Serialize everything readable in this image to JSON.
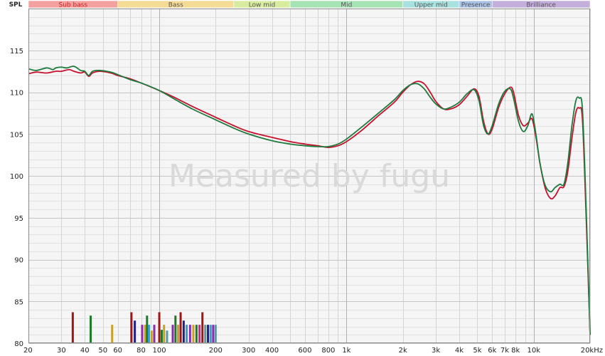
{
  "chart_data": {
    "type": "line",
    "y_axis_label": "SPL",
    "x_scale": "log",
    "xlim": [
      20,
      20000
    ],
    "ylim": [
      80,
      120
    ],
    "grid": true,
    "watermark": "Measured by fugu",
    "x_ticks": [
      {
        "v": 20,
        "label": "20"
      },
      {
        "v": 30,
        "label": "30"
      },
      {
        "v": 40,
        "label": "40"
      },
      {
        "v": 50,
        "label": "50"
      },
      {
        "v": 60,
        "label": "60"
      },
      {
        "v": 80,
        "label": "80"
      },
      {
        "v": 100,
        "label": "100"
      },
      {
        "v": 200,
        "label": "200"
      },
      {
        "v": 300,
        "label": "300"
      },
      {
        "v": 400,
        "label": "400"
      },
      {
        "v": 600,
        "label": "600"
      },
      {
        "v": 800,
        "label": "800"
      },
      {
        "v": 1000,
        "label": "1k"
      },
      {
        "v": 2000,
        "label": "2k"
      },
      {
        "v": 3000,
        "label": "3k"
      },
      {
        "v": 4000,
        "label": "4k"
      },
      {
        "v": 5000,
        "label": "5k"
      },
      {
        "v": 6000,
        "label": "6k"
      },
      {
        "v": 7000,
        "label": "7k"
      },
      {
        "v": 8000,
        "label": "8k"
      },
      {
        "v": 10000,
        "label": "10k"
      },
      {
        "v": 20000,
        "label": "20kHz"
      }
    ],
    "y_ticks": [
      80,
      85,
      90,
      95,
      100,
      105,
      110,
      115
    ],
    "bands": [
      {
        "name": "Sub bass",
        "from": 20,
        "to": 60,
        "color": "#f4a0a0",
        "text_color": "#cc2222"
      },
      {
        "name": "Bass",
        "from": 60,
        "to": 250,
        "color": "#f5dc96",
        "text_color": "#555555"
      },
      {
        "name": "Low mid",
        "from": 250,
        "to": 500,
        "color": "#d8eca0",
        "text_color": "#555555"
      },
      {
        "name": "Mid",
        "from": 500,
        "to": 2000,
        "color": "#a6e3b4",
        "text_color": "#555555"
      },
      {
        "name": "Upper mid",
        "from": 2000,
        "to": 4000,
        "color": "#a8e2de",
        "text_color": "#555555"
      },
      {
        "name": "Presence",
        "from": 4000,
        "to": 6000,
        "color": "#aac2e6",
        "text_color": "#555555"
      },
      {
        "name": "Brilliance",
        "from": 6000,
        "to": 20000,
        "color": "#c4aedb",
        "text_color": "#555555"
      }
    ],
    "series": [
      {
        "color": "#c8102e",
        "points": [
          [
            20,
            112.2
          ],
          [
            22,
            112.4
          ],
          [
            25,
            112.3
          ],
          [
            28,
            112.5
          ],
          [
            30,
            112.5
          ],
          [
            33,
            112.7
          ],
          [
            35,
            112.5
          ],
          [
            38,
            112.3
          ],
          [
            40,
            112.4
          ],
          [
            42,
            111.9
          ],
          [
            44,
            112.3
          ],
          [
            48,
            112.5
          ],
          [
            55,
            112.3
          ],
          [
            60,
            112.0
          ],
          [
            70,
            111.6
          ],
          [
            80,
            111.1
          ],
          [
            100,
            110.2
          ],
          [
            120,
            109.4
          ],
          [
            150,
            108.3
          ],
          [
            200,
            107.0
          ],
          [
            250,
            106.0
          ],
          [
            300,
            105.3
          ],
          [
            400,
            104.6
          ],
          [
            500,
            104.1
          ],
          [
            600,
            103.8
          ],
          [
            700,
            103.6
          ],
          [
            800,
            103.4
          ],
          [
            900,
            103.6
          ],
          [
            1000,
            104.1
          ],
          [
            1200,
            105.4
          ],
          [
            1500,
            107.3
          ],
          [
            1800,
            108.8
          ],
          [
            2000,
            110.0
          ],
          [
            2200,
            110.9
          ],
          [
            2400,
            111.3
          ],
          [
            2600,
            111.0
          ],
          [
            2800,
            110.0
          ],
          [
            3000,
            108.9
          ],
          [
            3300,
            108.0
          ],
          [
            3600,
            108.0
          ],
          [
            4000,
            108.5
          ],
          [
            4400,
            109.5
          ],
          [
            4800,
            110.4
          ],
          [
            5100,
            109.5
          ],
          [
            5400,
            106.5
          ],
          [
            5700,
            105.0
          ],
          [
            6000,
            105.6
          ],
          [
            6500,
            108.2
          ],
          [
            7000,
            109.8
          ],
          [
            7500,
            110.6
          ],
          [
            7800,
            110.0
          ],
          [
            8300,
            107.2
          ],
          [
            8800,
            106.0
          ],
          [
            9300,
            106.3
          ],
          [
            9800,
            106.8
          ],
          [
            10300,
            104.5
          ],
          [
            10800,
            101.5
          ],
          [
            11500,
            98.6
          ],
          [
            12300,
            97.3
          ],
          [
            13000,
            97.6
          ],
          [
            13800,
            98.6
          ],
          [
            14500,
            98.7
          ],
          [
            15200,
            100.5
          ],
          [
            16000,
            104.5
          ],
          [
            16800,
            107.6
          ],
          [
            17500,
            108.1
          ],
          [
            18200,
            106.8
          ],
          [
            19000,
            96.0
          ],
          [
            20000,
            81.0
          ]
        ]
      },
      {
        "color": "#1e7a3c",
        "points": [
          [
            20,
            112.8
          ],
          [
            22,
            112.6
          ],
          [
            25,
            112.9
          ],
          [
            27,
            112.7
          ],
          [
            28,
            112.9
          ],
          [
            30,
            113.0
          ],
          [
            32,
            112.9
          ],
          [
            35,
            113.1
          ],
          [
            38,
            112.6
          ],
          [
            40,
            112.5
          ],
          [
            42,
            112.0
          ],
          [
            44,
            112.5
          ],
          [
            48,
            112.6
          ],
          [
            55,
            112.4
          ],
          [
            60,
            112.1
          ],
          [
            70,
            111.5
          ],
          [
            80,
            111.1
          ],
          [
            100,
            110.2
          ],
          [
            120,
            109.2
          ],
          [
            150,
            108.0
          ],
          [
            200,
            106.7
          ],
          [
            250,
            105.7
          ],
          [
            300,
            105.0
          ],
          [
            400,
            104.2
          ],
          [
            500,
            103.8
          ],
          [
            600,
            103.6
          ],
          [
            700,
            103.5
          ],
          [
            800,
            103.5
          ],
          [
            900,
            103.8
          ],
          [
            1000,
            104.4
          ],
          [
            1200,
            105.8
          ],
          [
            1500,
            107.6
          ],
          [
            1800,
            109.1
          ],
          [
            2000,
            110.2
          ],
          [
            2200,
            110.9
          ],
          [
            2400,
            111.0
          ],
          [
            2600,
            110.4
          ],
          [
            2800,
            109.4
          ],
          [
            3000,
            108.6
          ],
          [
            3300,
            108.0
          ],
          [
            3600,
            108.2
          ],
          [
            4000,
            108.8
          ],
          [
            4400,
            109.8
          ],
          [
            4800,
            110.3
          ],
          [
            5100,
            109.0
          ],
          [
            5400,
            106.0
          ],
          [
            5700,
            105.0
          ],
          [
            6000,
            106.0
          ],
          [
            6500,
            108.6
          ],
          [
            7000,
            110.1
          ],
          [
            7500,
            110.4
          ],
          [
            7800,
            109.3
          ],
          [
            8300,
            106.5
          ],
          [
            8800,
            105.3
          ],
          [
            9300,
            106.0
          ],
          [
            9800,
            107.4
          ],
          [
            10300,
            104.8
          ],
          [
            10800,
            101.5
          ],
          [
            11500,
            98.9
          ],
          [
            12300,
            98.1
          ],
          [
            13000,
            98.6
          ],
          [
            13800,
            99.0
          ],
          [
            14500,
            99.0
          ],
          [
            15200,
            101.5
          ],
          [
            16000,
            106.0
          ],
          [
            16800,
            109.0
          ],
          [
            17500,
            109.3
          ],
          [
            18200,
            108.0
          ],
          [
            19000,
            97.0
          ],
          [
            20000,
            81.0
          ]
        ]
      }
    ],
    "bars": [
      {
        "x": 34.5,
        "top": 83.7,
        "color": "#a31515"
      },
      {
        "x": 43,
        "top": 83.3,
        "color": "#1e7a28"
      },
      {
        "x": 56,
        "top": 82.2,
        "color": "#c8a028"
      },
      {
        "x": 71,
        "top": 83.7,
        "color": "#a31515"
      },
      {
        "x": 74,
        "top": 82.7,
        "color": "#20208a"
      },
      {
        "x": 81,
        "top": 82.2,
        "color": "#8a2bb0"
      },
      {
        "x": 84,
        "top": 82.2,
        "color": "#c8a028"
      },
      {
        "x": 86,
        "top": 83.3,
        "color": "#1e7a28"
      },
      {
        "x": 88,
        "top": 82.2,
        "color": "#3a9ad0"
      },
      {
        "x": 91,
        "top": 81.5,
        "color": "#c8a028"
      },
      {
        "x": 94,
        "top": 82.2,
        "color": "#8a2bb0"
      },
      {
        "x": 100,
        "top": 83.7,
        "color": "#a31515"
      },
      {
        "x": 103,
        "top": 81.6,
        "color": "#1e7a28"
      },
      {
        "x": 106,
        "top": 82.2,
        "color": "#c8a028"
      },
      {
        "x": 110,
        "top": 81.5,
        "color": "#5a9aa0"
      },
      {
        "x": 118,
        "top": 82.2,
        "color": "#8a2bb0"
      },
      {
        "x": 122,
        "top": 83.3,
        "color": "#1e7a28"
      },
      {
        "x": 126,
        "top": 82.2,
        "color": "#c8a028"
      },
      {
        "x": 130,
        "top": 83.7,
        "color": "#a31515"
      },
      {
        "x": 135,
        "top": 82.7,
        "color": "#20208a"
      },
      {
        "x": 140,
        "top": 82.2,
        "color": "#3a9ad0"
      },
      {
        "x": 146,
        "top": 82.2,
        "color": "#8a2bb0"
      },
      {
        "x": 152,
        "top": 82.2,
        "color": "#c8a028"
      },
      {
        "x": 158,
        "top": 82.2,
        "color": "#1e7a28"
      },
      {
        "x": 164,
        "top": 82.2,
        "color": "#d02880"
      },
      {
        "x": 170,
        "top": 83.7,
        "color": "#a31515"
      },
      {
        "x": 176,
        "top": 82.2,
        "color": "#5a9aa0"
      },
      {
        "x": 182,
        "top": 82.2,
        "color": "#20208a"
      },
      {
        "x": 188,
        "top": 82.2,
        "color": "#3a9ad0"
      },
      {
        "x": 194,
        "top": 82.2,
        "color": "#8a2bb0"
      },
      {
        "x": 200,
        "top": 82.2,
        "color": "#5a9aa0"
      }
    ]
  }
}
